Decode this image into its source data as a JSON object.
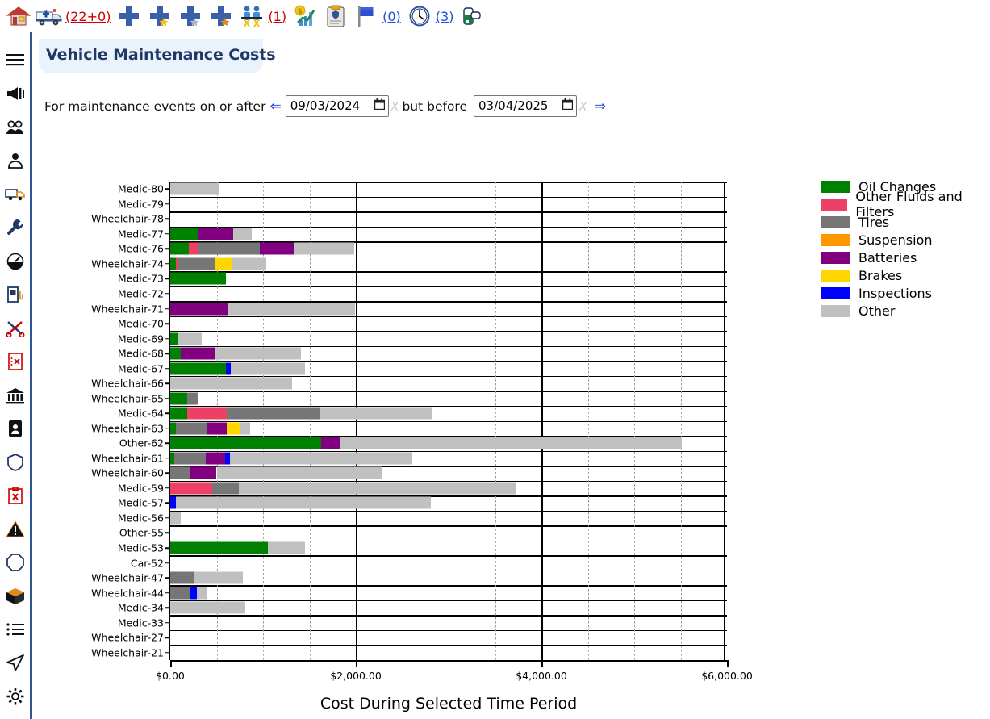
{
  "toolbar": {
    "items": [
      {
        "name": "home-icon",
        "icon": "house",
        "count": null
      },
      {
        "name": "ambulance-icon",
        "icon": "ambulance",
        "count": "(22+0)",
        "count_color": "#cc0000"
      },
      {
        "name": "plus-plain-icon",
        "icon": "cross",
        "count": null
      },
      {
        "name": "plus-gold-star-icon",
        "icon": "cross-gold",
        "count": null
      },
      {
        "name": "plus-silver-star-icon",
        "icon": "cross-silver",
        "count": null
      },
      {
        "name": "plus-bronze-star-icon",
        "icon": "cross-bronze",
        "count": null
      },
      {
        "name": "crew-icon",
        "icon": "people",
        "count": "(1)",
        "count_color": "#cc0000"
      },
      {
        "name": "finance-chart-icon",
        "icon": "money-chart",
        "count": null
      },
      {
        "name": "clipboard-icon",
        "icon": "clipboard",
        "count": null
      },
      {
        "name": "flag-icon",
        "icon": "flag",
        "count": "(0)",
        "count_color": "#1a4fd6"
      },
      {
        "name": "clock-icon",
        "icon": "clock",
        "count": "(3)",
        "count_color": "#1a4fd6"
      },
      {
        "name": "medication-icon",
        "icon": "pill",
        "count": null
      }
    ]
  },
  "sidebar": {
    "items": [
      {
        "name": "sidebar-item-menu",
        "icon": "hamburger"
      },
      {
        "name": "sidebar-item-announcements",
        "icon": "megaphone"
      },
      {
        "name": "sidebar-item-crew",
        "icon": "people"
      },
      {
        "name": "sidebar-item-person",
        "icon": "person"
      },
      {
        "name": "sidebar-item-vehicles",
        "icon": "truck"
      },
      {
        "name": "sidebar-item-maintenance",
        "icon": "wrench"
      },
      {
        "name": "sidebar-item-odometer",
        "icon": "gauge"
      },
      {
        "name": "sidebar-item-fuel",
        "icon": "fuel-pump"
      },
      {
        "name": "sidebar-item-repairs",
        "icon": "scissors"
      },
      {
        "name": "sidebar-item-out-of-service",
        "icon": "red-x-list"
      },
      {
        "name": "sidebar-item-bank",
        "icon": "bank"
      },
      {
        "name": "sidebar-item-id-card",
        "icon": "id-card"
      },
      {
        "name": "sidebar-item-shield",
        "icon": "shield"
      },
      {
        "name": "sidebar-item-incident-report",
        "icon": "red-clipboard-x"
      },
      {
        "name": "sidebar-item-alerts",
        "icon": "warning-triangle"
      },
      {
        "name": "sidebar-item-stop",
        "icon": "octagon"
      },
      {
        "name": "sidebar-item-inventory",
        "icon": "box"
      },
      {
        "name": "sidebar-item-lists",
        "icon": "list"
      },
      {
        "name": "sidebar-item-dispatch",
        "icon": "paper-plane"
      },
      {
        "name": "sidebar-item-settings",
        "icon": "gear"
      }
    ]
  },
  "page": {
    "title": "Vehicle Maintenance Costs"
  },
  "filter": {
    "label_before": "For maintenance events on or after",
    "back_arrow": "⇐",
    "start_date": "09/03/2024",
    "clear_start": "X",
    "label_middle": "but before",
    "end_date": "03/04/2025",
    "clear_end": "X",
    "forward_arrow": "⇒",
    "calendar_icon": "🗓"
  },
  "chart_data": {
    "type": "bar",
    "orientation": "horizontal",
    "stacked": true,
    "title": "",
    "xlabel": "Cost During Selected Time Period",
    "ylabel": "",
    "xlim": [
      0,
      6000
    ],
    "xticks": [
      0,
      2000,
      4000,
      6000
    ],
    "xticklabels": [
      "$0.00",
      "$2,000.00",
      "$4,000.00",
      "$6,000.00"
    ],
    "grid": true,
    "legend_position": "right",
    "series": [
      {
        "name": "Oil Changes",
        "color": "#008000"
      },
      {
        "name": "Other Fluids and Filters",
        "color": "#ec4064"
      },
      {
        "name": "Tires",
        "color": "#767676"
      },
      {
        "name": "Suspension",
        "color": "#ff9900"
      },
      {
        "name": "Batteries",
        "color": "#800080"
      },
      {
        "name": "Brakes",
        "color": "#ffd700"
      },
      {
        "name": "Inspections",
        "color": "#0000ff"
      },
      {
        "name": "Other",
        "color": "#c0c0c0"
      }
    ],
    "categories": [
      "Medic-80",
      "Medic-79",
      "Wheelchair-78",
      "Medic-77",
      "Medic-76",
      "Wheelchair-74",
      "Medic-73",
      "Medic-72",
      "Wheelchair-71",
      "Medic-70",
      "Medic-69",
      "Medic-68",
      "Medic-67",
      "Wheelchair-66",
      "Wheelchair-65",
      "Medic-64",
      "Wheelchair-63",
      "Other-62",
      "Wheelchair-61",
      "Wheelchair-60",
      "Medic-59",
      "Medic-57",
      "Medic-56",
      "Other-55",
      "Medic-53",
      "Car-52",
      "Wheelchair-47",
      "Wheelchair-44",
      "Medic-34",
      "Medic-33",
      "Wheelchair-27",
      "Wheelchair-21"
    ],
    "values": {
      "Oil Changes": [
        0,
        0,
        0,
        300,
        200,
        60,
        600,
        0,
        0,
        0,
        90,
        110,
        600,
        0,
        180,
        180,
        60,
        1630,
        40,
        0,
        0,
        0,
        0,
        0,
        1050,
        0,
        0,
        0,
        0,
        0,
        0,
        0
      ],
      "Other Fluids and Filters": [
        0,
        0,
        0,
        0,
        105,
        20,
        0,
        0,
        0,
        0,
        0,
        0,
        0,
        0,
        0,
        430,
        0,
        0,
        0,
        0,
        450,
        0,
        0,
        0,
        0,
        0,
        0,
        0,
        0,
        0,
        0,
        0
      ],
      "Tires": [
        0,
        0,
        0,
        0,
        660,
        400,
        0,
        0,
        0,
        0,
        0,
        0,
        0,
        0,
        120,
        1010,
        330,
        0,
        340,
        210,
        290,
        0,
        0,
        0,
        0,
        0,
        250,
        210,
        0,
        0,
        0,
        0
      ],
      "Suspension": [
        0,
        0,
        0,
        0,
        0,
        0,
        0,
        0,
        0,
        0,
        0,
        0,
        0,
        0,
        0,
        0,
        0,
        0,
        0,
        0,
        0,
        0,
        0,
        0,
        0,
        0,
        0,
        0,
        0,
        0,
        0,
        0
      ],
      "Batteries": [
        0,
        0,
        0,
        380,
        365,
        0,
        0,
        0,
        620,
        0,
        0,
        380,
        0,
        0,
        0,
        0,
        220,
        200,
        210,
        290,
        0,
        0,
        0,
        0,
        0,
        0,
        0,
        0,
        0,
        0,
        0,
        0
      ],
      "Brakes": [
        0,
        0,
        0,
        0,
        0,
        185,
        0,
        0,
        0,
        0,
        0,
        0,
        0,
        0,
        0,
        0,
        140,
        0,
        0,
        0,
        0,
        0,
        0,
        0,
        0,
        0,
        0,
        0,
        0,
        0,
        0,
        0
      ],
      "Inspections": [
        0,
        0,
        0,
        0,
        0,
        0,
        0,
        0,
        0,
        0,
        0,
        0,
        55,
        0,
        0,
        0,
        0,
        0,
        55,
        0,
        0,
        65,
        0,
        0,
        0,
        0,
        0,
        75,
        0,
        0,
        0,
        0
      ],
      "Other": [
        520,
        0,
        0,
        200,
        650,
        370,
        0,
        0,
        1370,
        0,
        250,
        915,
        800,
        1310,
        0,
        1200,
        115,
        3680,
        1960,
        1790,
        2990,
        2740,
        110,
        0,
        400,
        0,
        530,
        115,
        810,
        0,
        0,
        0
      ]
    }
  },
  "legend": {
    "entries": [
      {
        "label": "Oil Changes",
        "color": "#008000"
      },
      {
        "label": "Other Fluids and Filters",
        "color": "#ec4064"
      },
      {
        "label": "Tires",
        "color": "#767676"
      },
      {
        "label": "Suspension",
        "color": "#ff9900"
      },
      {
        "label": "Batteries",
        "color": "#800080"
      },
      {
        "label": "Brakes",
        "color": "#ffd700"
      },
      {
        "label": "Inspections",
        "color": "#0000ff"
      },
      {
        "label": "Other",
        "color": "#c0c0c0"
      }
    ]
  }
}
